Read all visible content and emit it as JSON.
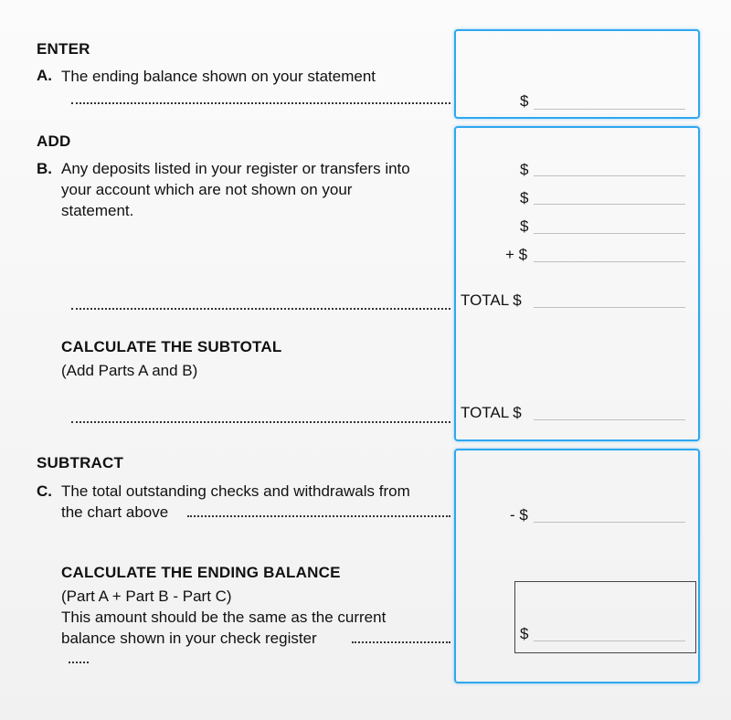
{
  "enter": {
    "heading": "ENTER",
    "letter": "A.",
    "text": "The ending balance shown on your statement",
    "symbol": "$"
  },
  "add": {
    "heading": "ADD",
    "letter": "B.",
    "text_lines": [
      "Any deposits listed in your register or transfers into",
      "your account which are not shown on your",
      "statement."
    ],
    "symbols": [
      "$",
      "$",
      "$",
      "+ $"
    ],
    "total_label": "TOTAL $"
  },
  "subtotal": {
    "heading": "CALCULATE THE SUBTOTAL",
    "note": "(Add Parts A and B)",
    "total_label": "TOTAL $"
  },
  "subtract": {
    "heading": "SUBTRACT",
    "letter": "C.",
    "text_lines": [
      "The total outstanding checks and withdrawals from",
      "the chart above"
    ],
    "symbol": "- $"
  },
  "ending": {
    "heading": "CALCULATE THE ENDING BALANCE",
    "lines": [
      "(Part A + Part B - Part C)",
      "This amount should be the same as the current",
      "balance shown in your check register"
    ],
    "symbol": "$"
  }
}
